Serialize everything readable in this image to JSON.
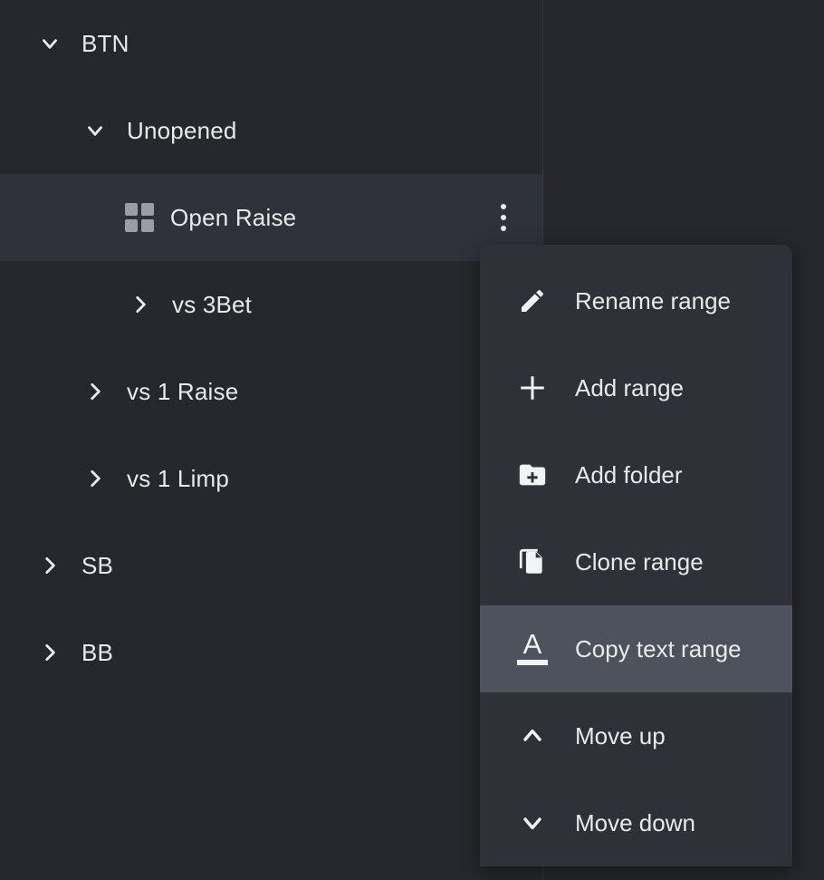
{
  "theme": {
    "background": "#26282d",
    "panel_divider": "#35383e",
    "row_selected": "#2f323a",
    "menu_background": "#2e3138",
    "menu_item_hover": "#4e525c",
    "text": "#e8eaec",
    "grid_icon": "#9a9da3"
  },
  "tree": {
    "items": [
      {
        "label": "BTN",
        "level": 0,
        "twisty": "chevron-down-icon",
        "expanded": true,
        "selected": false,
        "icon": null
      },
      {
        "label": "Unopened",
        "level": 1,
        "twisty": "chevron-down-icon",
        "expanded": true,
        "selected": false,
        "icon": null
      },
      {
        "label": "Open Raise",
        "level": 2,
        "twisty": null,
        "expanded": false,
        "selected": true,
        "icon": "grid-icon",
        "kebab": true
      },
      {
        "label": "vs 3Bet",
        "level": 2,
        "twisty": "chevron-right-icon",
        "expanded": false,
        "selected": false,
        "icon": null
      },
      {
        "label": "vs 1 Raise",
        "level": 1,
        "twisty": "chevron-right-icon",
        "expanded": false,
        "selected": false,
        "icon": null
      },
      {
        "label": "vs 1 Limp",
        "level": 1,
        "twisty": "chevron-right-icon",
        "expanded": false,
        "selected": false,
        "icon": null
      },
      {
        "label": "SB",
        "level": 0,
        "twisty": "chevron-right-icon",
        "expanded": false,
        "selected": false,
        "icon": null
      },
      {
        "label": "BB",
        "level": 0,
        "twisty": "chevron-right-icon",
        "expanded": false,
        "selected": false,
        "icon": null
      }
    ]
  },
  "context_menu": {
    "items": [
      {
        "label": "Rename range",
        "icon": "pencil-icon",
        "active": false
      },
      {
        "label": "Add range",
        "icon": "plus-icon",
        "active": false
      },
      {
        "label": "Add folder",
        "icon": "folder-plus-icon",
        "active": false
      },
      {
        "label": "Clone range",
        "icon": "copy-icon",
        "active": false
      },
      {
        "label": "Copy text range",
        "icon": "text-format-icon",
        "active": true
      },
      {
        "label": "Move up",
        "icon": "chevron-up-icon",
        "active": false
      },
      {
        "label": "Move down",
        "icon": "chevron-down-icon",
        "active": false
      }
    ]
  }
}
